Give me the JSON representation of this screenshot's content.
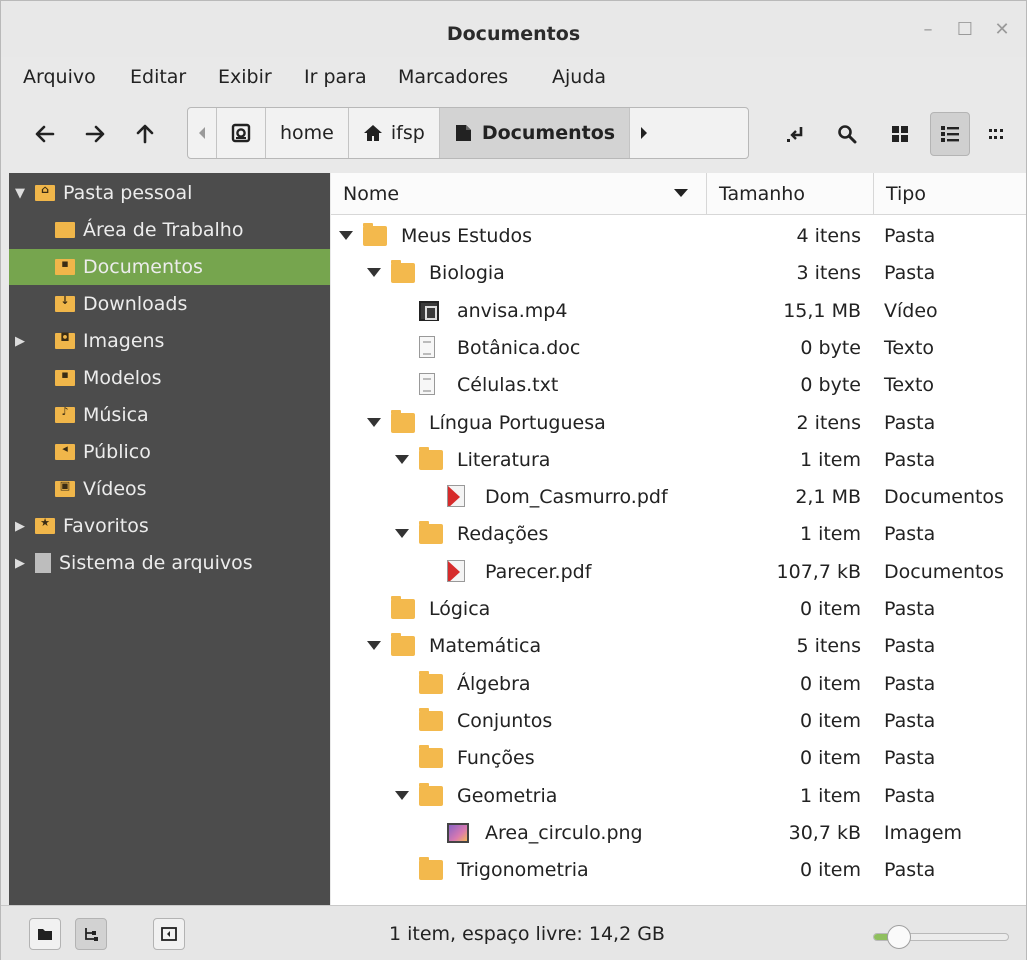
{
  "window": {
    "title": "Documentos"
  },
  "menubar": [
    "Arquivo",
    "Editar",
    "Exibir",
    "Ir para",
    "Marcadores",
    "Ajuda"
  ],
  "breadcrumbs": {
    "home": "home",
    "ifsp": "ifsp",
    "current": "Documentos"
  },
  "sidebar": [
    {
      "label": "Pasta pessoal",
      "expanded": true,
      "selected": false,
      "indent": 0,
      "icon": "home-folder-icon"
    },
    {
      "label": "Área de Trabalho",
      "selected": false,
      "indent": 1,
      "icon": "desktop-folder-icon"
    },
    {
      "label": "Documentos",
      "selected": true,
      "indent": 1,
      "icon": "documents-folder-icon"
    },
    {
      "label": "Downloads",
      "selected": false,
      "indent": 1,
      "icon": "downloads-folder-icon"
    },
    {
      "label": "Imagens",
      "collapsed": true,
      "selected": false,
      "indent": 1,
      "icon": "pictures-folder-icon"
    },
    {
      "label": "Modelos",
      "selected": false,
      "indent": 1,
      "icon": "templates-folder-icon"
    },
    {
      "label": "Música",
      "selected": false,
      "indent": 1,
      "icon": "music-folder-icon"
    },
    {
      "label": "Público",
      "selected": false,
      "indent": 1,
      "icon": "public-folder-icon"
    },
    {
      "label": "Vídeos",
      "selected": false,
      "indent": 1,
      "icon": "videos-folder-icon"
    },
    {
      "label": "Favoritos",
      "collapsed": true,
      "selected": false,
      "indent": 0,
      "icon": "favorites-folder-icon"
    },
    {
      "label": "Sistema de arquivos",
      "collapsed": true,
      "selected": false,
      "indent": 0,
      "icon": "drive-icon"
    }
  ],
  "columns": {
    "name": "Nome",
    "size": "Tamanho",
    "type": "Tipo"
  },
  "files": [
    {
      "name": "Meus Estudos",
      "size": "4 itens",
      "type": "Pasta",
      "level": 0,
      "kind": "folder",
      "expanded": true
    },
    {
      "name": "Biologia",
      "size": "3 itens",
      "type": "Pasta",
      "level": 1,
      "kind": "folder",
      "expanded": true
    },
    {
      "name": "anvisa.mp4",
      "size": "15,1 MB",
      "type": "Vídeo",
      "level": 2,
      "kind": "video"
    },
    {
      "name": "Botânica.doc",
      "size": "0 byte",
      "type": "Texto",
      "level": 2,
      "kind": "doc"
    },
    {
      "name": "Células.txt",
      "size": "0 byte",
      "type": "Texto",
      "level": 2,
      "kind": "doc"
    },
    {
      "name": "Língua Portuguesa",
      "size": "2 itens",
      "type": "Pasta",
      "level": 1,
      "kind": "folder",
      "expanded": true
    },
    {
      "name": "Literatura",
      "size": "1 item",
      "type": "Pasta",
      "level": 2,
      "kind": "folder",
      "expanded": true
    },
    {
      "name": "Dom_Casmurro.pdf",
      "size": "2,1 MB",
      "type": "Documentos",
      "level": 3,
      "kind": "pdf"
    },
    {
      "name": "Redações",
      "size": "1 item",
      "type": "Pasta",
      "level": 2,
      "kind": "folder",
      "expanded": true
    },
    {
      "name": "Parecer.pdf",
      "size": "107,7 kB",
      "type": "Documentos",
      "level": 3,
      "kind": "pdf"
    },
    {
      "name": "Lógica",
      "size": "0 item",
      "type": "Pasta",
      "level": 1,
      "kind": "folder",
      "expanded": false
    },
    {
      "name": "Matemática",
      "size": "5 itens",
      "type": "Pasta",
      "level": 1,
      "kind": "folder",
      "expanded": true
    },
    {
      "name": "Álgebra",
      "size": "0 item",
      "type": "Pasta",
      "level": 2,
      "kind": "folder",
      "expanded": false
    },
    {
      "name": "Conjuntos",
      "size": "0 item",
      "type": "Pasta",
      "level": 2,
      "kind": "folder",
      "expanded": false
    },
    {
      "name": "Funções",
      "size": "0 item",
      "type": "Pasta",
      "level": 2,
      "kind": "folder",
      "expanded": false
    },
    {
      "name": "Geometria",
      "size": "1 item",
      "type": "Pasta",
      "level": 2,
      "kind": "folder",
      "expanded": true
    },
    {
      "name": "Area_circulo.png",
      "size": "30,7 kB",
      "type": "Imagem",
      "level": 3,
      "kind": "img"
    },
    {
      "name": "Trigonometria",
      "size": "0 item",
      "type": "Pasta",
      "level": 2,
      "kind": "folder",
      "expanded": false
    }
  ],
  "status": {
    "text": "1 item, espaço livre: 14,2 GB",
    "zoom_level": 0.12
  },
  "colors": {
    "accent": "#76a54e",
    "sidebar_bg": "#4c4c4c",
    "folder": "#f3b94d"
  }
}
